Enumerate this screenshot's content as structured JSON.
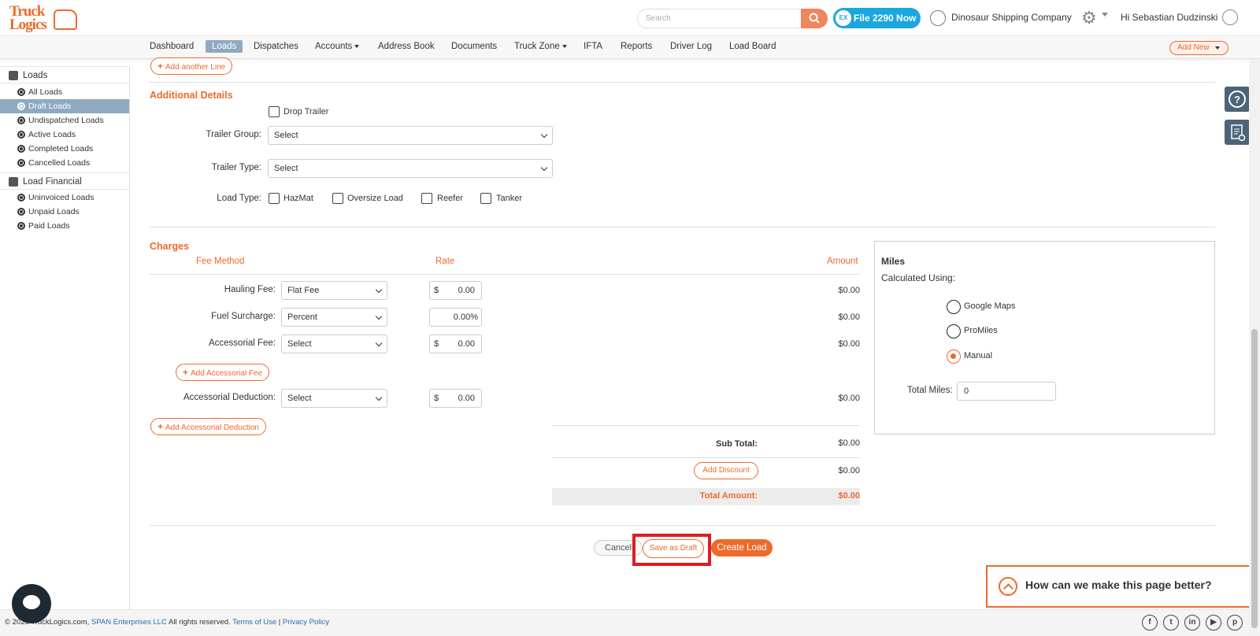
{
  "header": {
    "logo_line1": "Truck",
    "logo_line2": "Logics",
    "search_placeholder": "Search",
    "file2290_badge": "EX",
    "file2290_label": "File 2290 Now",
    "company": "Dinosaur Shipping Company",
    "greeting": "Hi Sebastian Dudzinski"
  },
  "nav": {
    "items": [
      "Dashboard",
      "Loads",
      "Dispatches",
      "Accounts",
      "Address Book",
      "Documents",
      "Truck Zone",
      "IFTA",
      "Reports",
      "Driver Log",
      "Load Board"
    ],
    "active": "Loads",
    "add_new": "Add New"
  },
  "sidebar": {
    "loads_header": "Loads",
    "loads_items": [
      "All Loads",
      "Draft Loads",
      "Undispatched Loads",
      "Active Loads",
      "Completed Loads",
      "Cancelled Loads"
    ],
    "active_item": "Draft Loads",
    "financial_header": "Load Financial",
    "financial_items": [
      "Uninvoiced Loads",
      "Unpaid Loads",
      "Paid Loads"
    ]
  },
  "form": {
    "add_another_line": "Add another Line",
    "additional_details_title": "Additional Details",
    "drop_trailer": "Drop Trailer",
    "trailer_group_label": "Trailer Group:",
    "trailer_group_value": "Select",
    "trailer_type_label": "Trailer Type:",
    "trailer_type_value": "Select",
    "load_type_label": "Load Type:",
    "load_types": [
      "HazMat",
      "Oversize Load",
      "Reefer",
      "Tanker"
    ]
  },
  "charges": {
    "title": "Charges",
    "col_fee_method": "Fee Method",
    "col_rate": "Rate",
    "col_amount": "Amount",
    "hauling_label": "Hauling Fee:",
    "hauling_method": "Flat Fee",
    "hauling_currency": "$",
    "hauling_rate": "0.00",
    "hauling_amount": "$0.00",
    "fuel_label": "Fuel Surcharge:",
    "fuel_method": "Percent",
    "fuel_rate": "0.00%",
    "fuel_amount": "$0.00",
    "accessorial_label": "Accessorial Fee:",
    "accessorial_method": "Select",
    "accessorial_currency": "$",
    "accessorial_rate": "0.00",
    "accessorial_amount": "$0.00",
    "add_accessorial_fee": "Add Accessorial Fee",
    "deduction_label": "Accessorial Deduction:",
    "deduction_method": "Select",
    "deduction_currency": "$",
    "deduction_rate": "0.00",
    "deduction_amount": "$0.00",
    "add_accessorial_deduction": "Add Accessorial Deduction",
    "subtotal_label": "Sub Total:",
    "subtotal_value": "$0.00",
    "add_discount": "Add Discount",
    "discount_value": "$0.00",
    "total_label": "Total Amount:",
    "total_value": "$0.00"
  },
  "miles": {
    "title": "Miles",
    "calculated_using": "Calculated Using:",
    "options": [
      "Google Maps",
      "ProMiles",
      "Manual"
    ],
    "selected": "Manual",
    "total_miles_label": "Total Miles:",
    "total_miles_value": "0"
  },
  "actions": {
    "cancel": "Cancel",
    "save_draft": "Save as Draft",
    "create_load": "Create Load"
  },
  "feedback": "How can we make this page better?",
  "footer": {
    "copyright": "© 2025 TruckLogics.com,",
    "company_link": "SPAN Enterprises LLC",
    "rights": "All rights reserved.",
    "terms": "Terms of Use",
    "privacy": "Privacy Policy"
  },
  "colors": {
    "accent": "#ec6a2c",
    "nav_active": "#8faac0",
    "highlight": "#e01b22"
  }
}
